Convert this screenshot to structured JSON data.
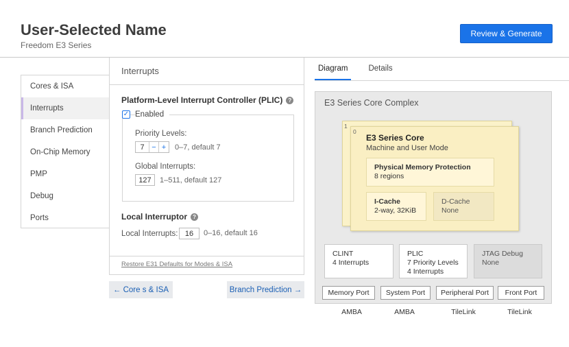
{
  "header": {
    "title": "User-Selected Name",
    "subtitle": "Freedom E3 Series",
    "primary_button": "Review & Generate"
  },
  "sidebar": {
    "items": [
      {
        "label": "Cores & ISA",
        "active": false
      },
      {
        "label": "Interrupts",
        "active": true
      },
      {
        "label": "Branch Prediction",
        "active": false
      },
      {
        "label": "On-Chip Memory",
        "active": false
      },
      {
        "label": "PMP",
        "active": false
      },
      {
        "label": "Debug",
        "active": false
      },
      {
        "label": "Ports",
        "active": false
      }
    ]
  },
  "panel": {
    "title": "Interrupts",
    "plic": {
      "title": "Platform-Level Interrupt Controller (PLIC)",
      "enabled_label": "Enabled",
      "enabled": true,
      "priority_label": "Priority Levels:",
      "priority_value": "7",
      "priority_minus": "−",
      "priority_plus": "+",
      "priority_hint": "0–7, default 7",
      "global_label": "Global Interrupts:",
      "global_value": "127",
      "global_hint": "1–511, default 127"
    },
    "local": {
      "title": "Local Interruptor",
      "label": "Local Interrupts:",
      "value": "16",
      "hint": "0–16, default 16"
    },
    "restore_link": "Restore E31 Defaults for Modes & ISA",
    "help_glyph": "?",
    "checkmark": "✓"
  },
  "nav": {
    "prev_label": "←  Core s & ISA",
    "next_label": "Branch Prediction →"
  },
  "tabs": [
    {
      "label": "Diagram",
      "active": true
    },
    {
      "label": "Details",
      "active": false
    }
  ],
  "diagram": {
    "title": "E3 Series Core Complex",
    "core_back_index": "1",
    "core_front_index": "0",
    "core_title": "E3 Series Core",
    "core_subtitle": "Machine and User Mode",
    "pmp_title": "Physical Memory Protection",
    "pmp_value": "8 regions",
    "icache_title": "I-Cache",
    "icache_value": "2-way, 32KiB",
    "dcache_title": "D-Cache",
    "dcache_value": "None",
    "clint_title": "CLINT",
    "clint_value": "4 Interrupts",
    "plic_title": "PLIC",
    "plic_value1": "7 Priority Levels",
    "plic_value2": "4 Interrupts",
    "jtag_title": "JTAG Debug",
    "jtag_value": "None",
    "ports": [
      {
        "label": "Memory Port",
        "bus": "AMBA"
      },
      {
        "label": "System Port",
        "bus": "AMBA"
      },
      {
        "label": "Peripheral Port",
        "bus": "TileLink"
      },
      {
        "label": "Front Port",
        "bus": "TileLink"
      }
    ]
  },
  "colors": {
    "accent": "#1a73e8",
    "core_fill": "#faefc3",
    "diagram_bg": "#e9e9e9"
  }
}
